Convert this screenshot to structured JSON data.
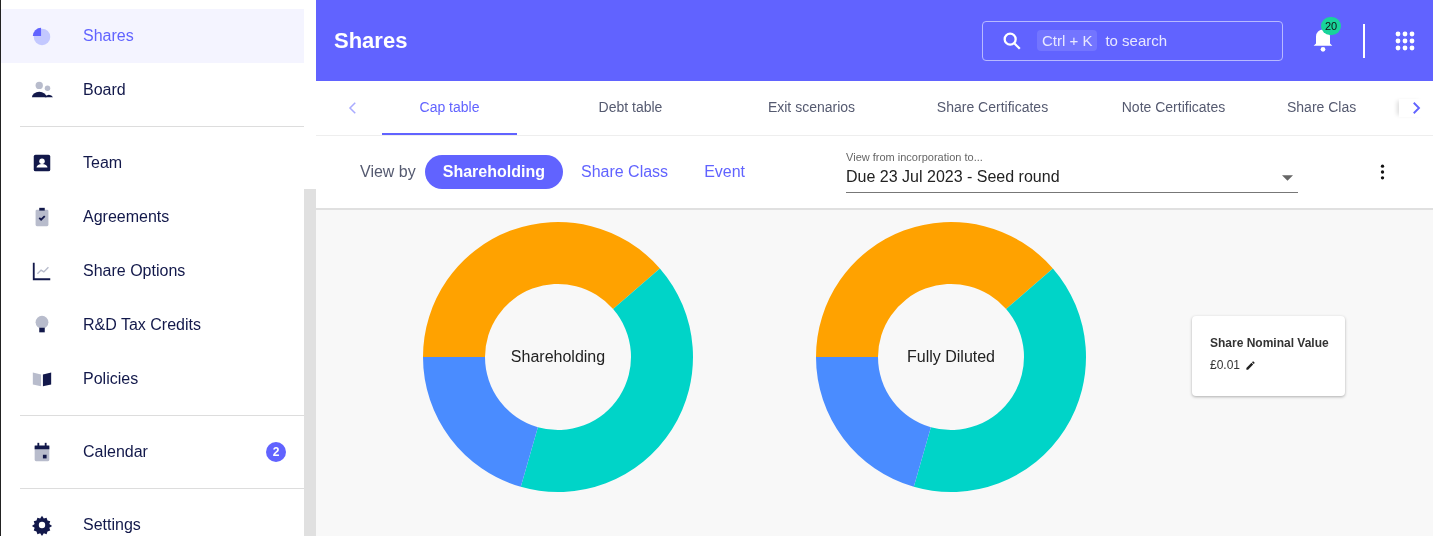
{
  "sidebar": {
    "sections": [
      {
        "items": [
          {
            "label": "Shares",
            "kind": "pie",
            "selected": true
          },
          {
            "label": "Board",
            "kind": "people",
            "selected": false
          }
        ]
      },
      {
        "items": [
          {
            "label": "Team",
            "kind": "badge",
            "selected": false
          },
          {
            "label": "Agreements",
            "kind": "clipboard",
            "selected": false
          },
          {
            "label": "Share Options",
            "kind": "chart",
            "selected": false
          },
          {
            "label": "R&D Tax Credits",
            "kind": "bulb",
            "selected": false
          },
          {
            "label": "Policies",
            "kind": "book",
            "selected": false
          }
        ]
      },
      {
        "items": [
          {
            "label": "Calendar",
            "kind": "calendar",
            "selected": false,
            "badge": "2"
          }
        ]
      },
      {
        "items": [
          {
            "label": "Settings",
            "kind": "gear",
            "selected": false
          }
        ]
      }
    ]
  },
  "header": {
    "title": "Shares",
    "search": {
      "shortcut": "Ctrl + K",
      "placeholder": "to search"
    },
    "notifications": "20"
  },
  "tabs": [
    {
      "label": "Cap table",
      "selected": true
    },
    {
      "label": "Debt table",
      "selected": false
    },
    {
      "label": "Exit scenarios",
      "selected": false
    },
    {
      "label": "Share Certificates",
      "selected": false
    },
    {
      "label": "Note Certificates",
      "selected": false
    },
    {
      "label": "Share Clas",
      "selected": false
    }
  ],
  "toolbar": {
    "view_by": "View by",
    "options": [
      {
        "label": "Shareholding",
        "selected": true
      },
      {
        "label": "Share Class",
        "selected": false
      },
      {
        "label": "Event",
        "selected": false
      }
    ],
    "dropdown": {
      "label": "View from incorporation to...",
      "value": "Due 23 Jul 2023 - Seed round"
    }
  },
  "donuts": [
    {
      "label": "Shareholding"
    },
    {
      "label": "Fully Diluted"
    }
  ],
  "card": {
    "title": "Share Nominal Value",
    "value": "£0.01"
  }
}
